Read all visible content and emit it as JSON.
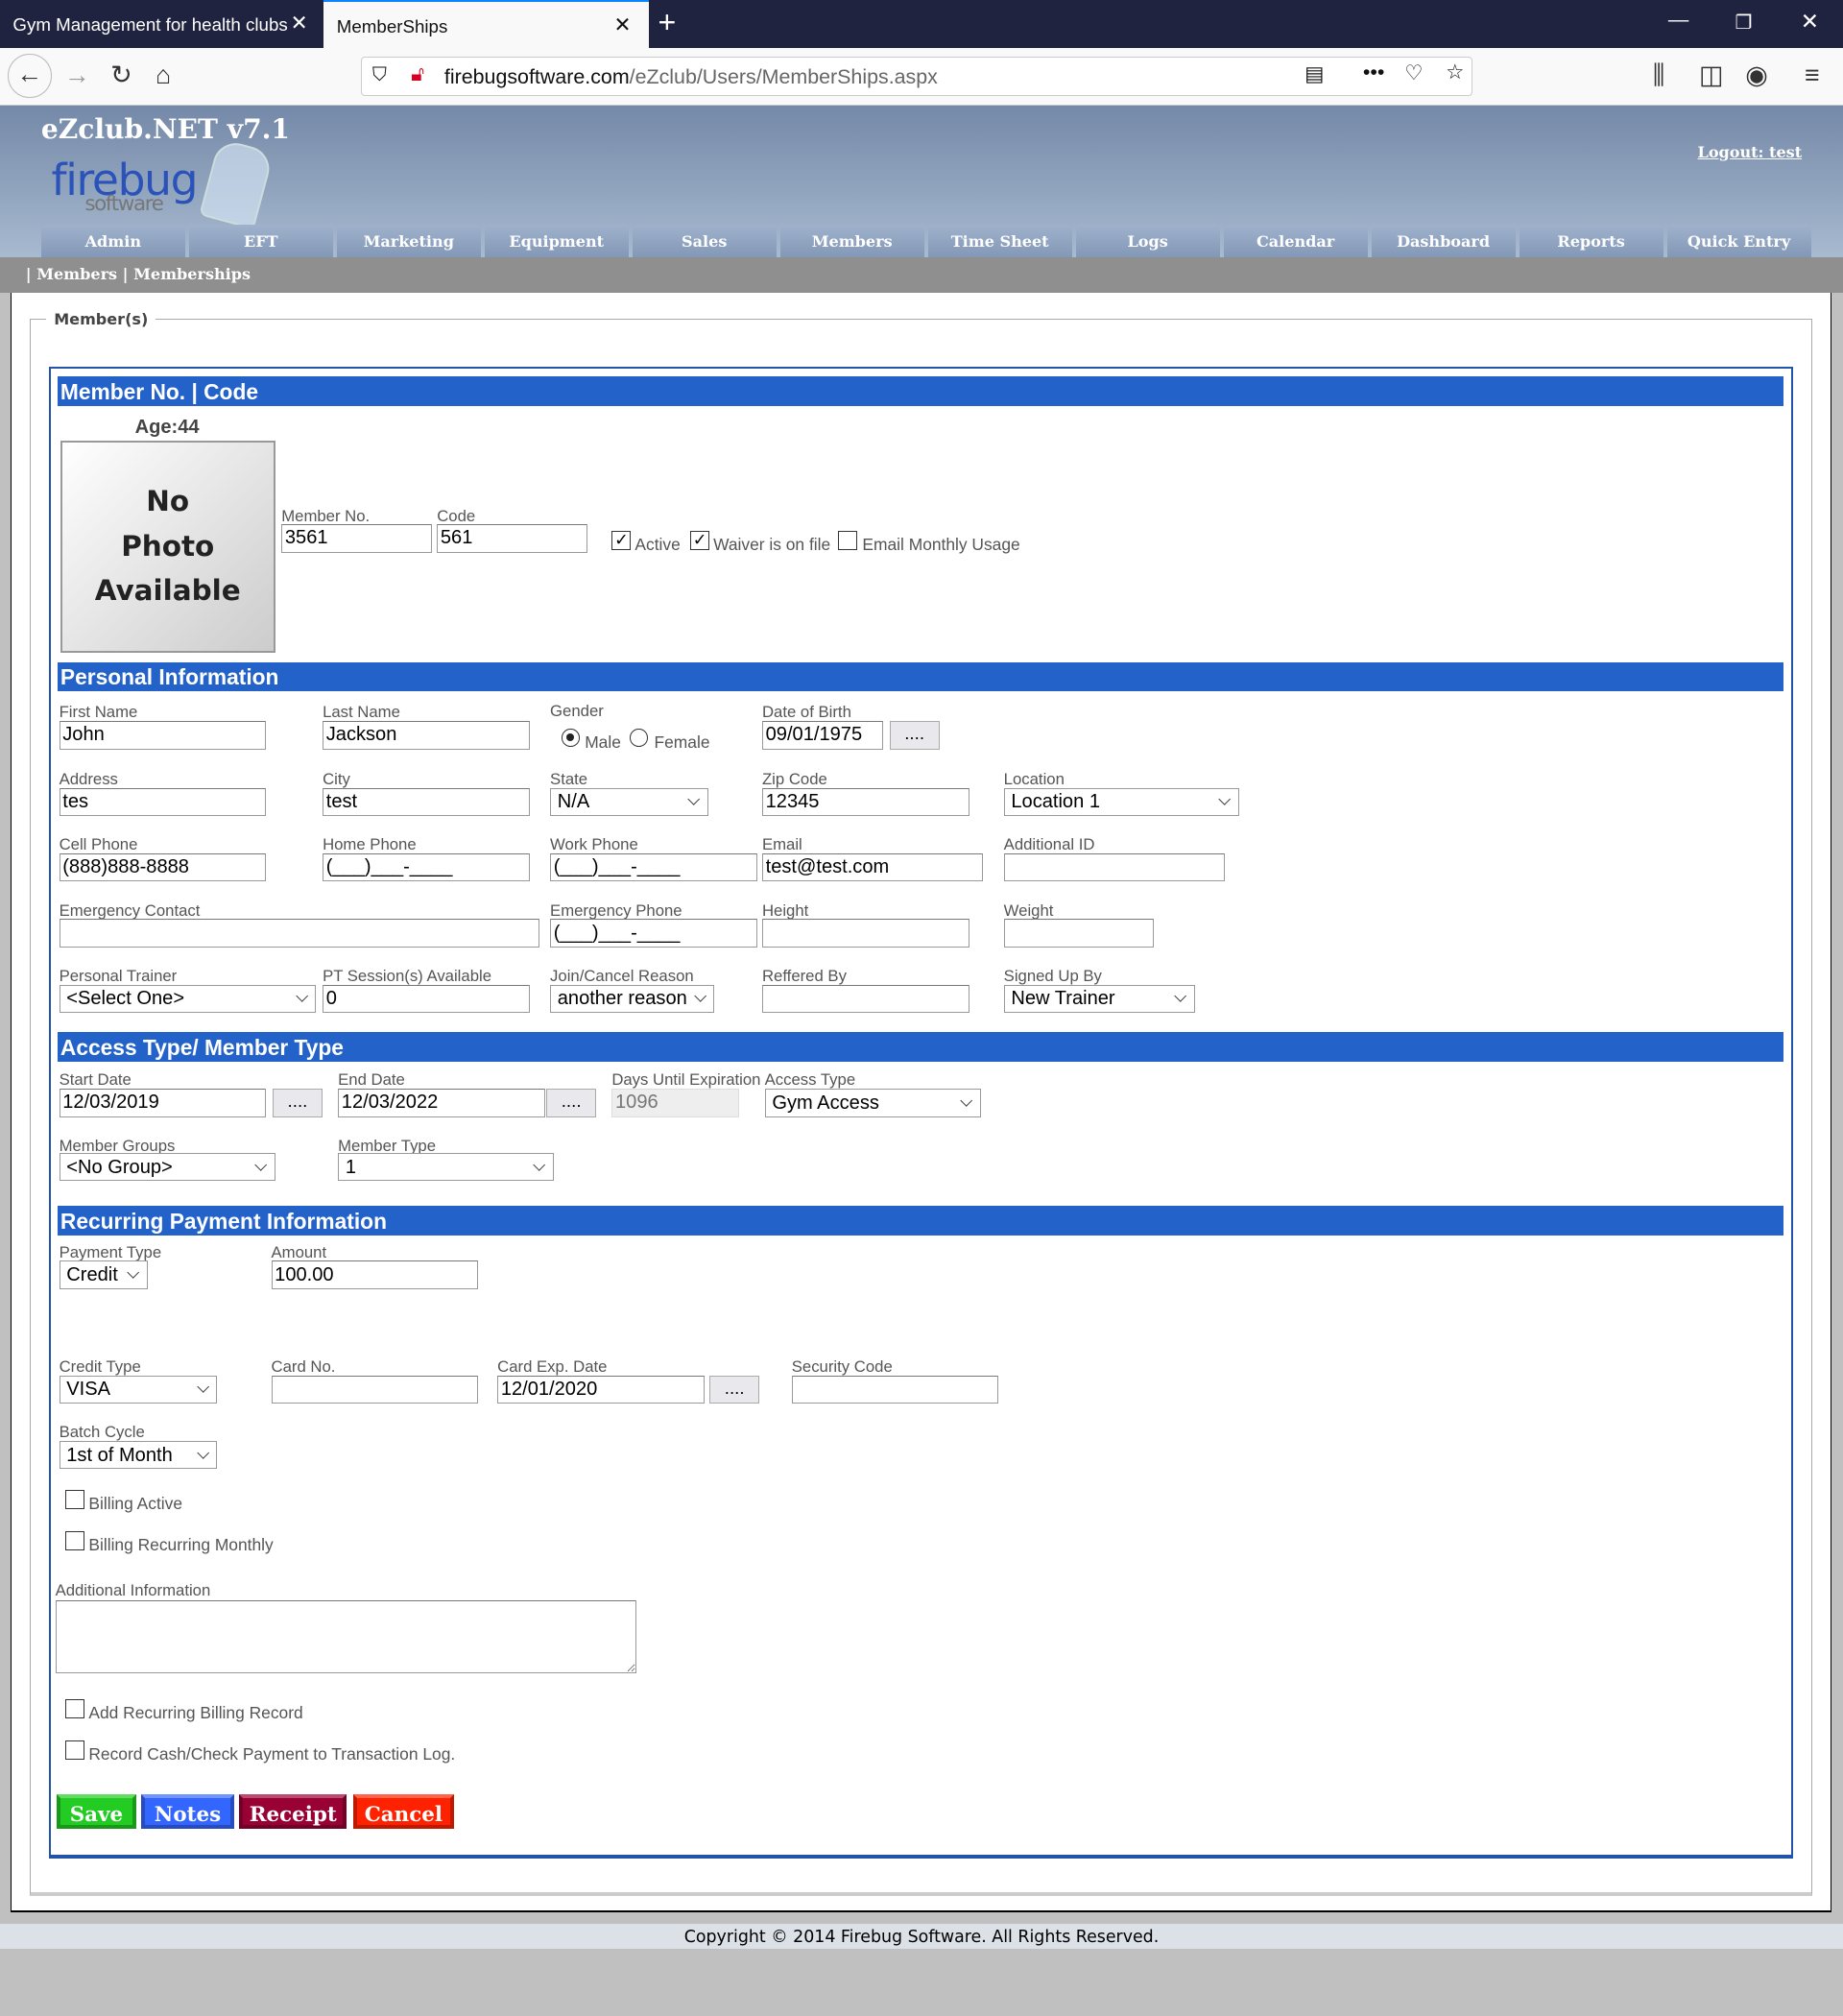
{
  "browser": {
    "tabs": [
      {
        "label": "Gym Management for health clubs"
      },
      {
        "label": "MemberShips"
      }
    ],
    "url_domain": "firebugsoftware.com",
    "url_path": "/eZclub/Users/MemberShips.aspx"
  },
  "header": {
    "app_title": "eZclub.NET v7.1",
    "logo_text": "firebug software",
    "logout": "Logout: test"
  },
  "menu": [
    "Admin",
    "EFT",
    "Marketing",
    "Equipment",
    "Sales",
    "Members",
    "Time Sheet",
    "Logs",
    "Calendar",
    "Dashboard",
    "Reports",
    "Quick Entry"
  ],
  "breadcrumb": {
    "sep": "|",
    "items": [
      "Members",
      "Memberships"
    ]
  },
  "legend": "Member(s)",
  "sections": {
    "member": "Member No. | Code",
    "personal": "Personal Information",
    "access": "Access Type/ Member Type",
    "recurring": "Recurring Payment Information"
  },
  "member": {
    "age": "Age:44",
    "photo": [
      "No",
      "Photo",
      "Available"
    ],
    "member_no": {
      "label": "Member No.",
      "value": "3561"
    },
    "code": {
      "label": "Code",
      "value": "561"
    },
    "active": {
      "label": "Active",
      "checked": true
    },
    "waiver": {
      "label": "Waiver is on file",
      "checked": true
    },
    "email_usage": {
      "label": "Email Monthly Usage",
      "checked": false
    }
  },
  "personal": {
    "first_name": {
      "label": "First Name",
      "value": "John"
    },
    "last_name": {
      "label": "Last Name",
      "value": "Jackson"
    },
    "gender": {
      "label": "Gender",
      "options": [
        "Male",
        "Female"
      ],
      "selected": "Male"
    },
    "dob": {
      "label": "Date of Birth",
      "value": "09/01/1975"
    },
    "address": {
      "label": "Address",
      "value": "tes"
    },
    "city": {
      "label": "City",
      "value": "test"
    },
    "state": {
      "label": "State",
      "value": "N/A"
    },
    "zip": {
      "label": "Zip Code",
      "value": "12345"
    },
    "location": {
      "label": "Location",
      "value": "Location 1"
    },
    "cell": {
      "label": "Cell Phone",
      "value": "(888)888-8888"
    },
    "home": {
      "label": "Home Phone",
      "value": "(___)___-____"
    },
    "work": {
      "label": "Work Phone",
      "value": "(___)___-____"
    },
    "email": {
      "label": "Email",
      "value": "test@test.com"
    },
    "additional_id": {
      "label": "Additional ID",
      "value": ""
    },
    "emergency_contact": {
      "label": "Emergency Contact",
      "value": ""
    },
    "emergency_phone": {
      "label": "Emergency Phone",
      "value": "(___)___-____"
    },
    "height": {
      "label": "Height",
      "value": ""
    },
    "weight": {
      "label": "Weight",
      "value": ""
    },
    "trainer": {
      "label": "Personal Trainer",
      "value": "<Select One>"
    },
    "pt_sessions": {
      "label": "PT Session(s) Available",
      "value": "0"
    },
    "join_reason": {
      "label": "Join/Cancel Reason",
      "value": "another reason"
    },
    "referred": {
      "label": "Reffered By",
      "value": ""
    },
    "signed_up": {
      "label": "Signed Up By",
      "value": "New Trainer"
    }
  },
  "access": {
    "start": {
      "label": "Start Date",
      "value": "12/03/2019"
    },
    "end": {
      "label": "End Date",
      "value": "12/03/2022"
    },
    "days": {
      "label": "Days Until Expiration",
      "value": "1096"
    },
    "type": {
      "label": "Access Type",
      "value": "Gym Access"
    },
    "groups": {
      "label": "Member Groups",
      "value": "<No Group>"
    },
    "member_type": {
      "label": "Member Type",
      "value": "1"
    }
  },
  "recurring": {
    "payment_type": {
      "label": "Payment Type",
      "value": "Credit"
    },
    "amount": {
      "label": "Amount",
      "value": "100.00"
    },
    "credit_type": {
      "label": "Credit Type",
      "value": "VISA"
    },
    "card_no": {
      "label": "Card No.",
      "value": ""
    },
    "card_exp": {
      "label": "Card Exp. Date",
      "value": "12/01/2020"
    },
    "security": {
      "label": "Security Code",
      "value": ""
    },
    "batch": {
      "label": "Batch Cycle",
      "value": "1st of Month"
    },
    "billing_active": {
      "label": "Billing Active",
      "checked": false
    },
    "billing_monthly": {
      "label": "Billing Recurring Monthly",
      "checked": false
    },
    "additional_info": {
      "label": "Additional Information",
      "value": ""
    },
    "add_record": {
      "label": "Add Recurring Billing Record",
      "checked": false
    },
    "record_cash": {
      "label": "Record Cash/Check Payment to Transaction Log.",
      "checked": false
    }
  },
  "date_button": "....",
  "buttons": {
    "save": "Save",
    "notes": "Notes",
    "receipt": "Receipt",
    "cancel": "Cancel"
  },
  "colors": {
    "section": "#2362c8",
    "save": "#22cc22",
    "notes": "#3366ff",
    "receipt": "#990033",
    "cancel": "#ff2200"
  },
  "footer": "Copyright © 2014 Firebug Software. All Rights Reserved."
}
